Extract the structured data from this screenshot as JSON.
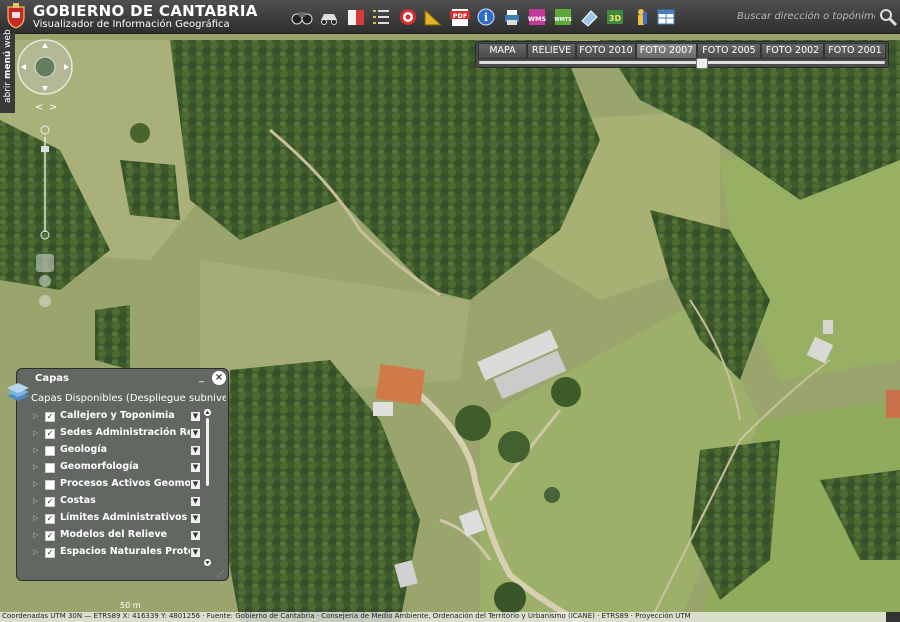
{
  "header": {
    "title": "GOBIERNO DE CANTABRIA",
    "subtitle": "Visualizador de Información Geográfica",
    "colors": {
      "background": "#3c3c3c",
      "text": "#ffffff"
    }
  },
  "toolbar": {
    "tools": [
      {
        "icon": "binoculars-icon"
      },
      {
        "icon": "route-car-icon"
      },
      {
        "icon": "book-icon"
      },
      {
        "icon": "list-icon"
      },
      {
        "icon": "target-icon"
      },
      {
        "icon": "ruler-icon"
      },
      {
        "icon": "pdf-icon",
        "label": "PDF"
      },
      {
        "icon": "info-icon",
        "label": "i"
      },
      {
        "icon": "print-icon"
      },
      {
        "icon": "wms-icon",
        "label": "WMS"
      },
      {
        "icon": "wmts-icon",
        "label": "WMTS"
      },
      {
        "icon": "eraser-icon"
      },
      {
        "icon": "3d-icon",
        "label": "3D"
      },
      {
        "icon": "person-icon"
      },
      {
        "icon": "table-icon"
      }
    ]
  },
  "search": {
    "placeholder": "Buscar dirección o topónimo"
  },
  "side_menu": {
    "label_prefix": "abrir ",
    "label_bold": "menú",
    "label_suffix": " web"
  },
  "base_layers": {
    "buttons": [
      {
        "label": "MAPA",
        "active": false
      },
      {
        "label": "RELIEVE",
        "active": false
      },
      {
        "label": "FOTO 2010",
        "active": false
      },
      {
        "label": "FOTO 2007",
        "active": true
      },
      {
        "label": "FOTO 2005",
        "active": false
      },
      {
        "label": "FOTO 2002",
        "active": false
      },
      {
        "label": "FOTO 2001",
        "active": false
      }
    ],
    "opacity": 0.55
  },
  "capas": {
    "title": "Capas",
    "minimize": "_",
    "close": "×",
    "subtitle": "Capas Disponibles (Despliegue subniveles",
    "layers": [
      {
        "label": "Callejero y Toponimia",
        "checked": true
      },
      {
        "label": "Sedes Administración Regional",
        "checked": true
      },
      {
        "label": "Geología",
        "checked": false
      },
      {
        "label": "Geomorfología",
        "checked": false
      },
      {
        "label": "Procesos Activos Geomorfológicos",
        "checked": false
      },
      {
        "label": "Costas",
        "checked": true
      },
      {
        "label": "Límites Administrativos",
        "checked": true
      },
      {
        "label": "Modelos del Relieve",
        "checked": true
      },
      {
        "label": "Espacios Naturales Protegidos",
        "checked": true
      }
    ]
  },
  "scale": {
    "label": "50 m"
  },
  "status": {
    "text": "Coordenadas UTM 30N — ETRS89 X: 416339  Y: 4801256 ·  Fuente: Gobierno de Cantabria · Consejería de Medio Ambiente, Ordenación del Territorio y Urbanismo (ICANE) · ETRS89 · Proyección UTM"
  }
}
